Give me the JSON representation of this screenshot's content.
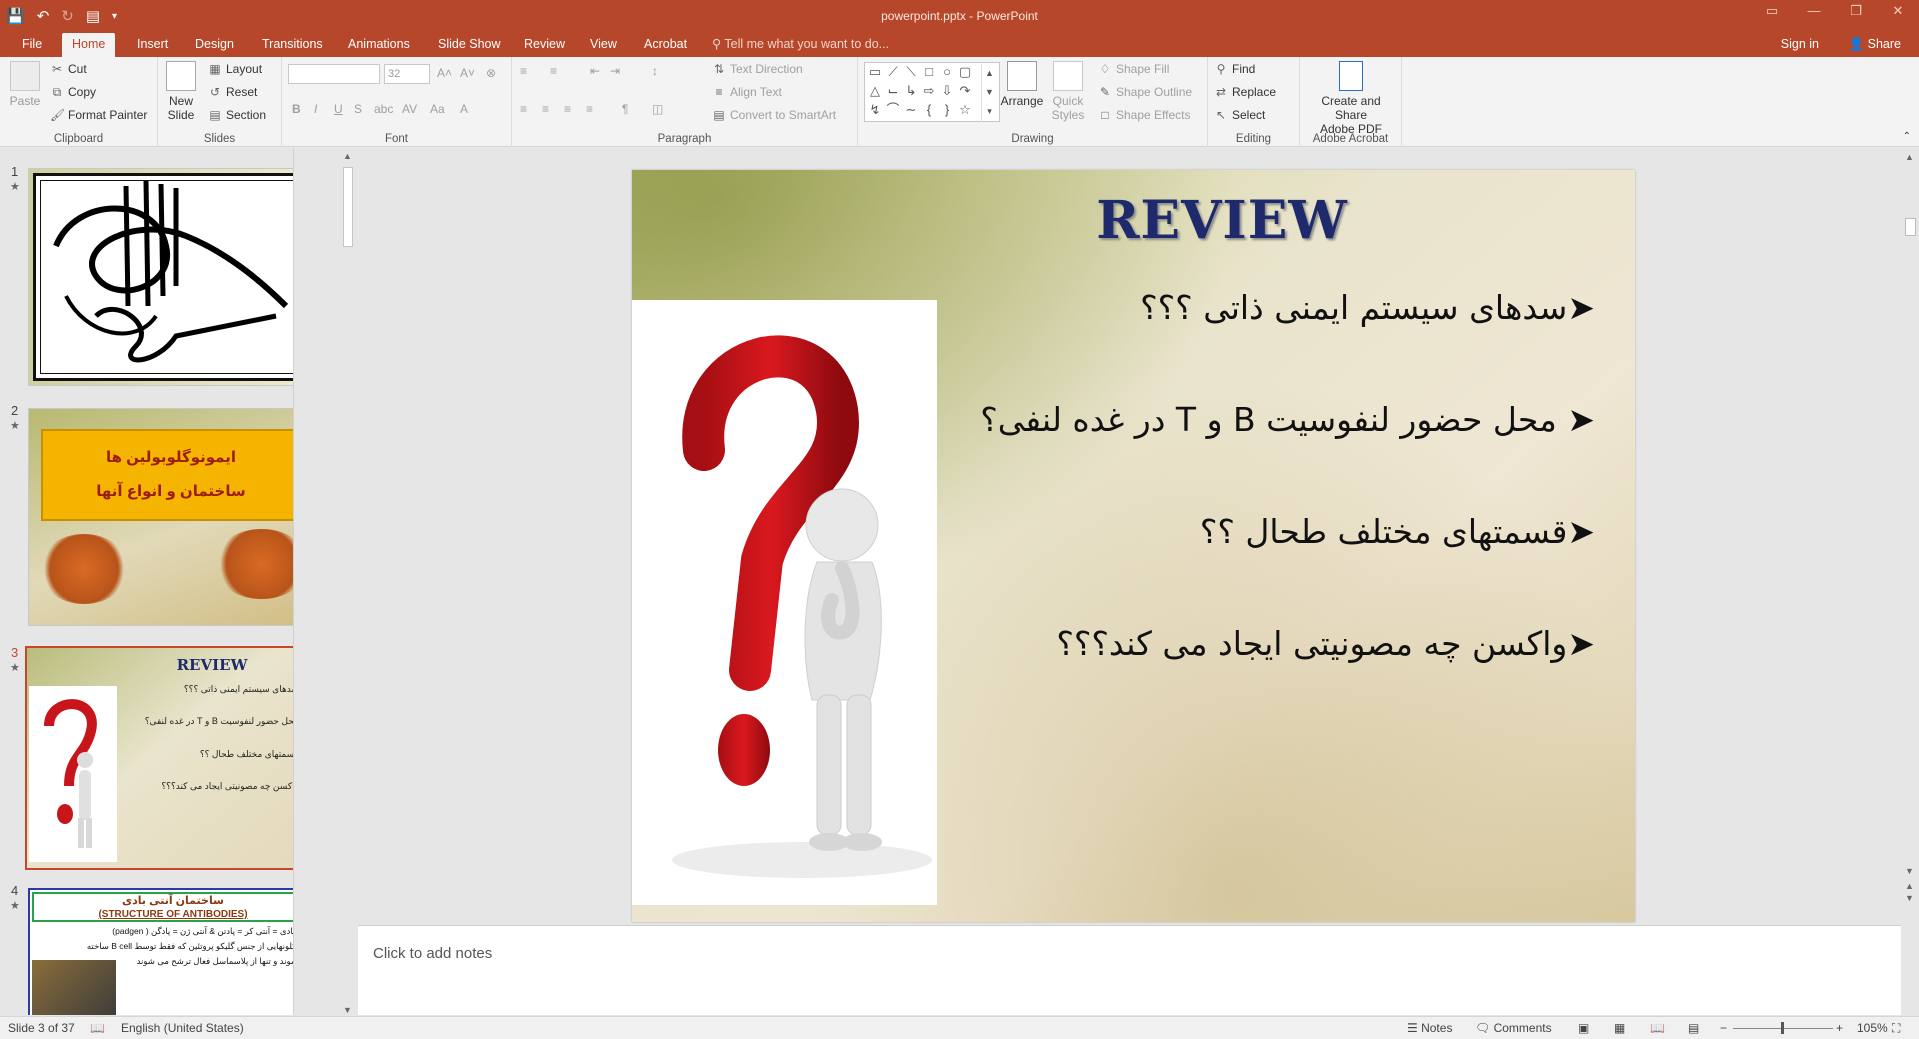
{
  "window": {
    "title": "powerpoint.pptx - PowerPoint"
  },
  "tabs": [
    {
      "label": "File"
    },
    {
      "label": "Home"
    },
    {
      "label": "Insert"
    },
    {
      "label": "Design"
    },
    {
      "label": "Transitions"
    },
    {
      "label": "Animations"
    },
    {
      "label": "Slide Show"
    },
    {
      "label": "Review"
    },
    {
      "label": "View"
    },
    {
      "label": "Acrobat"
    }
  ],
  "tell_me": "Tell me what you want to do...",
  "account": {
    "sign_in": "Sign in",
    "share": "Share"
  },
  "ribbon": {
    "clipboard": {
      "label": "Clipboard",
      "paste": "Paste",
      "cut": "Cut",
      "copy": "Copy",
      "format_painter": "Format Painter"
    },
    "slides": {
      "label": "Slides",
      "new_slide": "New",
      "new_slide_2": "Slide",
      "layout": "Layout",
      "reset": "Reset",
      "section": "Section"
    },
    "font": {
      "label": "Font",
      "size": "32"
    },
    "paragraph": {
      "label": "Paragraph",
      "text_direction": "Text Direction",
      "align_text": "Align Text",
      "convert_smartart": "Convert to SmartArt"
    },
    "drawing": {
      "label": "Drawing",
      "arrange": "Arrange",
      "quick_styles": "Quick",
      "quick_styles_2": "Styles",
      "shape_fill": "Shape Fill",
      "shape_outline": "Shape Outline",
      "shape_effects": "Shape Effects"
    },
    "editing": {
      "label": "Editing",
      "find": "Find",
      "replace": "Replace",
      "select": "Select"
    },
    "acrobat": {
      "label": "Adobe Acrobat",
      "create_share": "Create and Share",
      "create_share_2": "Adobe PDF"
    }
  },
  "thumbnails": [
    {
      "number": "1"
    },
    {
      "number": "2",
      "line1": "ایمونوگلوبولین ها",
      "line2": "ساختمان و انواع آنها"
    },
    {
      "number": "3",
      "title": "REVIEW",
      "b1": "سدهای سیستم ایمنی ذاتی ؟؟؟",
      "b2": "محل حضور لنفوسیت B و T در غده لنفی؟",
      "b3": "قسمتهای مختلف طحال ؟؟",
      "b4": "واکسن چه مصونیتی ایجاد می کند؟؟؟"
    },
    {
      "number": "4",
      "title": "ساختمان آنتی بادی",
      "subtitle": "(STRUCTURE OF ANTIBODIES)",
      "l1": "آنتی بادی = آنتی کر = پادتن & آنتی ژن = پادگن ( padgen)",
      "l2": "مونوکلونهایی از جنس گلیکو پروتئین که فقط توسط B cell ساخته",
      "l3": "می شوند و تنها از پلاسماسل فعال ترشح می شوند"
    }
  ],
  "slide": {
    "title": "REVIEW",
    "bullets": [
      "سدهای سیستم ایمنی ذاتی ؟؟؟",
      "محل حضور لنفوسیت B و T در غده لنفی؟",
      "قسمتهای مختلف طحال ؟؟",
      "واکسن چه مصونیتی ایجاد می کند؟؟؟"
    ]
  },
  "notes_placeholder": "Click to add notes",
  "status": {
    "slide_info": "Slide 3 of 37",
    "language": "English (United States)",
    "notes": "Notes",
    "comments": "Comments",
    "zoom": "105%"
  },
  "colors": {
    "accent": "#b7472a",
    "title_blue": "#1e2a6b",
    "question_red": "#c8141b"
  }
}
